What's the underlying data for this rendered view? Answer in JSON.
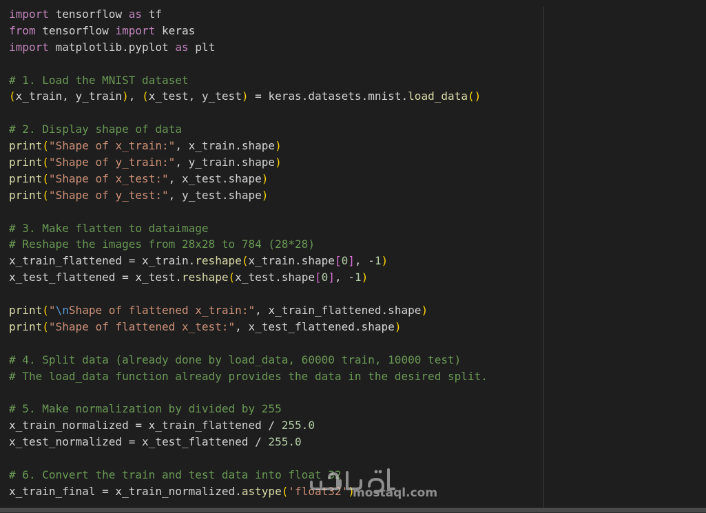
{
  "editor": {
    "lines": [
      [
        [
          "kw",
          "import"
        ],
        [
          "id",
          " tensorflow "
        ],
        [
          "kw",
          "as"
        ],
        [
          "id",
          " tf"
        ]
      ],
      [
        [
          "kw",
          "from"
        ],
        [
          "id",
          " tensorflow "
        ],
        [
          "kw",
          "import"
        ],
        [
          "id",
          " keras"
        ]
      ],
      [
        [
          "kw",
          "import"
        ],
        [
          "id",
          " matplotlib.pyplot "
        ],
        [
          "kw",
          "as"
        ],
        [
          "id",
          " plt"
        ]
      ],
      [],
      [
        [
          "cmt",
          "# 1. Load the MNIST dataset"
        ]
      ],
      [
        [
          "p1",
          "("
        ],
        [
          "id",
          "x_train, y_train"
        ],
        [
          "p1",
          ")"
        ],
        [
          "id",
          ", "
        ],
        [
          "p1",
          "("
        ],
        [
          "id",
          "x_test, y_test"
        ],
        [
          "p1",
          ")"
        ],
        [
          "id",
          " = keras.datasets.mnist."
        ],
        [
          "fn",
          "load_data"
        ],
        [
          "p1",
          "()"
        ]
      ],
      [],
      [
        [
          "cmt",
          "# 2. Display shape of data"
        ]
      ],
      [
        [
          "fn",
          "print"
        ],
        [
          "p1",
          "("
        ],
        [
          "str",
          "\"Shape of x_train:\""
        ],
        [
          "id",
          ", x_train.shape"
        ],
        [
          "p1",
          ")"
        ]
      ],
      [
        [
          "fn",
          "print"
        ],
        [
          "p1",
          "("
        ],
        [
          "str",
          "\"Shape of y_train:\""
        ],
        [
          "id",
          ", y_train.shape"
        ],
        [
          "p1",
          ")"
        ]
      ],
      [
        [
          "fn",
          "print"
        ],
        [
          "p1",
          "("
        ],
        [
          "str",
          "\"Shape of x_test:\""
        ],
        [
          "id",
          ", x_test.shape"
        ],
        [
          "p1",
          ")"
        ]
      ],
      [
        [
          "fn",
          "print"
        ],
        [
          "p1",
          "("
        ],
        [
          "str",
          "\"Shape of y_test:\""
        ],
        [
          "id",
          ", y_test.shape"
        ],
        [
          "p1",
          ")"
        ]
      ],
      [],
      [
        [
          "cmt",
          "# 3. Make flatten to dataimage"
        ]
      ],
      [
        [
          "cmt",
          "# Reshape the images from 28x28 to 784 (28*28)"
        ]
      ],
      [
        [
          "id",
          "x_train_flattened = x_train."
        ],
        [
          "fn",
          "reshape"
        ],
        [
          "p1",
          "("
        ],
        [
          "id",
          "x_train.shape"
        ],
        [
          "p2",
          "["
        ],
        [
          "num",
          "0"
        ],
        [
          "p2",
          "]"
        ],
        [
          "id",
          ", -"
        ],
        [
          "num",
          "1"
        ],
        [
          "p1",
          ")"
        ]
      ],
      [
        [
          "id",
          "x_test_flattened = x_test."
        ],
        [
          "fn",
          "reshape"
        ],
        [
          "p1",
          "("
        ],
        [
          "id",
          "x_test.shape"
        ],
        [
          "p2",
          "["
        ],
        [
          "num",
          "0"
        ],
        [
          "p2",
          "]"
        ],
        [
          "id",
          ", -"
        ],
        [
          "num",
          "1"
        ],
        [
          "p1",
          ")"
        ]
      ],
      [],
      [
        [
          "fn",
          "print"
        ],
        [
          "p1",
          "("
        ],
        [
          "str",
          "\""
        ],
        [
          "kw2",
          "\\n"
        ],
        [
          "str",
          "Shape of flattened x_train:\""
        ],
        [
          "id",
          ", x_train_flattened.shape"
        ],
        [
          "p1",
          ")"
        ]
      ],
      [
        [
          "fn",
          "print"
        ],
        [
          "p1",
          "("
        ],
        [
          "str",
          "\"Shape of flattened x_test:\""
        ],
        [
          "id",
          ", x_test_flattened.shape"
        ],
        [
          "p1",
          ")"
        ]
      ],
      [],
      [
        [
          "cmt",
          "# 4. Split data (already done by load_data, 60000 train, 10000 test)"
        ]
      ],
      [
        [
          "cmt",
          "# The load_data function already provides the data in the desired split."
        ]
      ],
      [],
      [
        [
          "cmt",
          "# 5. Make normalization by divided by 255"
        ]
      ],
      [
        [
          "id",
          "x_train_normalized = x_train_flattened / "
        ],
        [
          "num",
          "255.0"
        ]
      ],
      [
        [
          "id",
          "x_test_normalized = x_test_flattened / "
        ],
        [
          "num",
          "255.0"
        ]
      ],
      [],
      [
        [
          "cmt",
          "# 6. Convert the train and test data into float 32"
        ]
      ],
      [
        [
          "id",
          "x_train_final = x_train_normalized."
        ],
        [
          "fn",
          "astype"
        ],
        [
          "p1",
          "("
        ],
        [
          "str",
          "'float32'"
        ],
        [
          "p1",
          ")"
        ]
      ]
    ]
  },
  "watermark": {
    "text": "mostaql.com"
  },
  "colors": {
    "background": "#1e1e1e",
    "keyword": "#c586c0",
    "function": "#dcdcaa",
    "string": "#ce9178",
    "number": "#b5cea8",
    "comment": "#6a9955",
    "bracket_outer": "#ffd700",
    "bracket_inner": "#da70d6"
  }
}
